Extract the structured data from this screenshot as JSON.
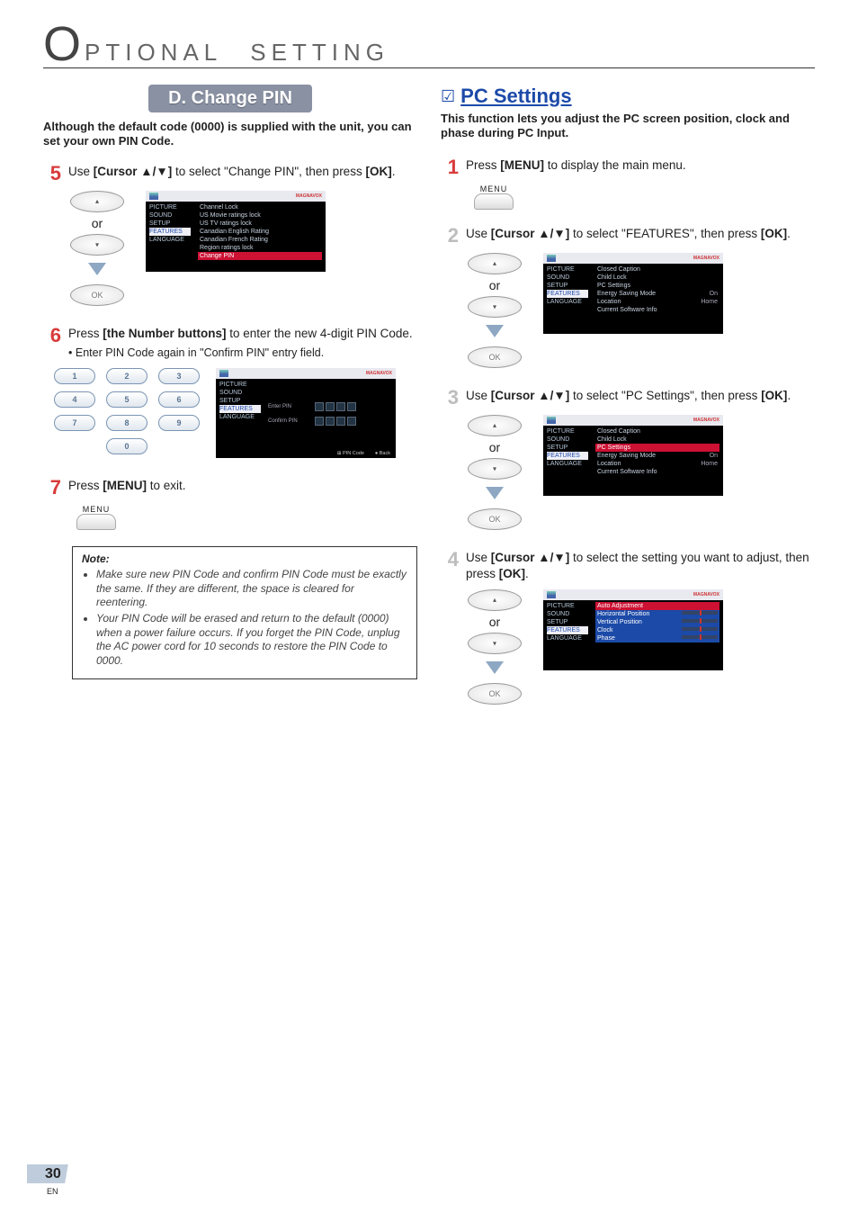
{
  "header": {
    "big": "O",
    "rest": "PTIONAL　SETTING"
  },
  "left": {
    "badge": "D. Change PIN",
    "intro": "Although the default code (0000) is supplied with the unit, you can set your own PIN Code.",
    "step5": {
      "num": "5",
      "text_prefix": "Use ",
      "text_bold1": "[Cursor ▲/▼]",
      "text_mid": " to select \"Change PIN\", then press ",
      "text_bold2": "[OK]",
      "text_suffix": "."
    },
    "or": "or",
    "ok": "OK",
    "menu5": {
      "left": [
        "PICTURE",
        "SOUND",
        "SETUP",
        "FEATURES",
        "LANGUAGE"
      ],
      "left_sel_index": 3,
      "right": [
        "Channel Lock",
        "US Movie ratings lock",
        "US TV ratings lock",
        "Canadian English Rating",
        "Canadian French Rating",
        "Region ratings lock",
        "Change PIN"
      ],
      "right_red_index": 6
    },
    "step6": {
      "num": "6",
      "text_prefix": "Press ",
      "text_bold1": "[the Number buttons]",
      "text_mid": " to enter the new 4-digit PIN Code.",
      "bullet": "Enter PIN Code again in \"Confirm PIN\" entry field."
    },
    "numpad": [
      "1",
      "2",
      "3",
      "4",
      "5",
      "6",
      "7",
      "8",
      "9",
      "0"
    ],
    "pin_screen": {
      "left": [
        "PICTURE",
        "SOUND",
        "SETUP",
        "FEATURES",
        "LANGUAGE"
      ],
      "left_sel_index": 3,
      "enter_label": "Enter PIN",
      "confirm_label": "Confirm PIN",
      "footer_left": "PIN Code",
      "footer_right": "Back"
    },
    "step7": {
      "num": "7",
      "text_prefix": "Press ",
      "text_bold1": "[MENU]",
      "text_suffix": " to exit."
    },
    "menu_label": "MENU",
    "note": {
      "title": "Note:",
      "items": [
        "Make sure new PIN Code and confirm PIN Code must be exactly the same. If they are different, the space is cleared for reentering.",
        "Your PIN Code will be erased and return to the default (0000) when a power failure occurs.\nIf you forget the PIN Code, unplug the AC power cord for 10 seconds to restore the PIN Code to 0000."
      ]
    }
  },
  "right": {
    "title": "PC Settings",
    "intro": "This function lets you adjust the PC screen position, clock and phase during PC Input.",
    "step1": {
      "num": "1",
      "text_prefix": "Press ",
      "text_bold1": "[MENU]",
      "text_suffix": " to display the main menu."
    },
    "menu_label": "MENU",
    "step2": {
      "num": "2",
      "text_prefix": "Use ",
      "text_bold1": "[Cursor ▲/▼]",
      "text_mid": " to select \"FEATURES\", then press ",
      "text_bold2": "[OK]",
      "text_suffix": "."
    },
    "menu2": {
      "left": [
        "PICTURE",
        "SOUND",
        "SETUP",
        "FEATURES",
        "LANGUAGE"
      ],
      "left_sel_index": 3,
      "right": [
        {
          "label": "Closed Caption",
          "val": ""
        },
        {
          "label": "Child Lock",
          "val": ""
        },
        {
          "label": "PC Settings",
          "val": ""
        },
        {
          "label": "Energy Saving Mode",
          "val": "On"
        },
        {
          "label": "Location",
          "val": "Home"
        },
        {
          "label": "Current Software Info",
          "val": ""
        }
      ]
    },
    "step3": {
      "num": "3",
      "text_prefix": "Use ",
      "text_bold1": "[Cursor ▲/▼]",
      "text_mid": " to select \"PC Settings\", then press ",
      "text_bold2": "[OK]",
      "text_suffix": "."
    },
    "menu3": {
      "left": [
        "PICTURE",
        "SOUND",
        "SETUP",
        "FEATURES",
        "LANGUAGE"
      ],
      "left_sel_index": 3,
      "right": [
        {
          "label": "Closed Caption",
          "val": ""
        },
        {
          "label": "Child Lock",
          "val": ""
        },
        {
          "label": "PC Settings",
          "val": ""
        },
        {
          "label": "Energy Saving Mode",
          "val": "On"
        },
        {
          "label": "Location",
          "val": "Home"
        },
        {
          "label": "Current Software Info",
          "val": ""
        }
      ],
      "right_red_index": 2
    },
    "step4": {
      "num": "4",
      "text_prefix": "Use ",
      "text_bold1": "[Cursor ▲/▼]",
      "text_mid": " to select the setting you want to adjust, then press ",
      "text_bold2": "[OK]",
      "text_suffix": "."
    },
    "menu4": {
      "left": [
        "PICTURE",
        "SOUND",
        "SETUP",
        "FEATURES",
        "LANGUAGE"
      ],
      "left_sel_index": 3,
      "right": [
        "Auto Adjustment",
        "Horizontal Position",
        "Vertical Position",
        "Clock",
        "Phase"
      ],
      "right_red_index": 0,
      "sliders_from": 1
    },
    "or": "or",
    "ok": "OK"
  },
  "brand": "MAGNAVOX",
  "page_number": "30",
  "page_lang": "EN"
}
